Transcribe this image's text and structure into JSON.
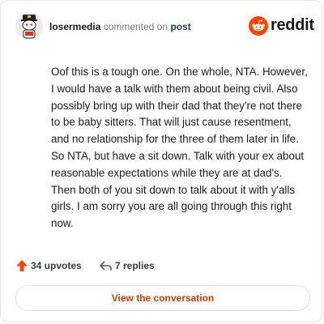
{
  "header": {
    "username": "losermedia",
    "action_text": "commented on",
    "post_link": "post",
    "brand": "reddit",
    "brand_color": "#ff4500",
    "avatar_icon": "snoo-avatar-icon"
  },
  "comment": {
    "body": "Oof this is a tough one. On the whole, NTA. However, I would have a talk with them about being civil. Also possibly bring up with their dad that they're not there to be baby sitters. That will just cause resentment, and no relationship for the three of them later in life. So NTA, but have a sit down. Talk with your ex about reasonable expectations while they are at dad's. Then both of you sit down to talk about it with y'alls girls. I am sorry you are all going through this right now."
  },
  "actions": {
    "upvotes": "34 upvotes",
    "upvote_icon": "upvote-arrow-icon",
    "upvote_color": "#ff4500",
    "replies": "7 replies",
    "reply_icon": "reply-arrow-icon"
  },
  "cta": {
    "label": "View the conversation",
    "color": "#d93a00"
  }
}
